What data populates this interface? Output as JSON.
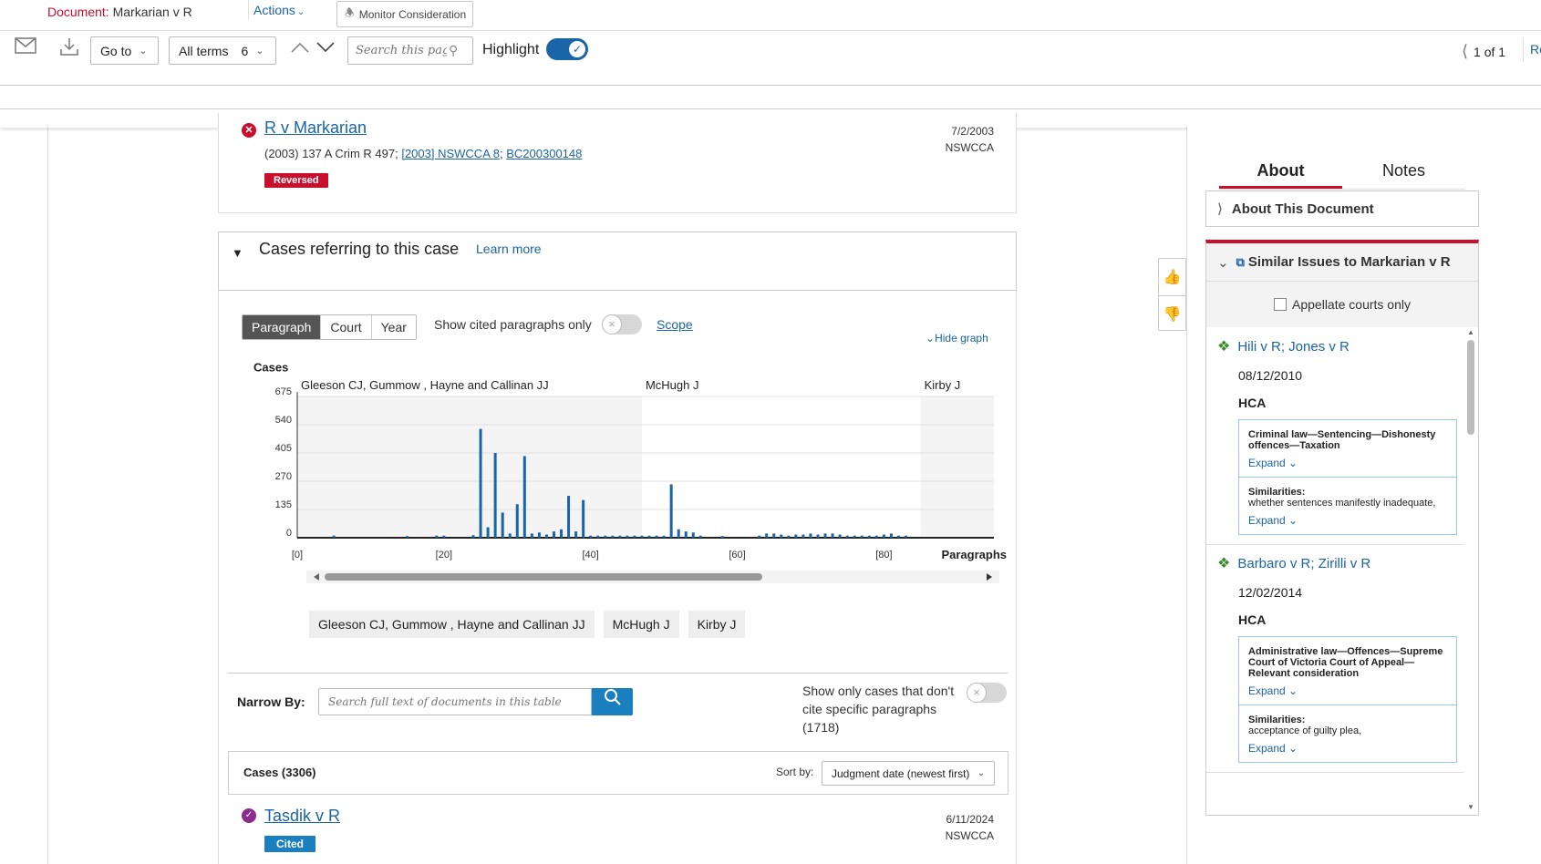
{
  "doc_bar": {
    "document_label": "Document:",
    "document_name": "Markarian v R",
    "actions": "Actions",
    "monitor": "Monitor Consideration"
  },
  "toolbar": {
    "goto": "Go to",
    "all_terms": "All terms",
    "term_count": "6",
    "search_placeholder": "Search this page",
    "highlight": "Highlight",
    "highlight_on": true,
    "pager": "1 of 1",
    "pager_next": "Re"
  },
  "top_case": {
    "title": "R v Markarian",
    "citation_prefix": "(2003) 137 A Crim R 497;",
    "citation_link1": "[2003] NSWCCA 8",
    "citation_sep": ";",
    "citation_link2": "BC200300148",
    "badge": "Reversed",
    "date": "7/2/2003",
    "court": "NSWCCA"
  },
  "cases_referring": {
    "title": "Cases referring to this case",
    "learn_more": "Learn more",
    "tabs": [
      "Paragraph",
      "Court",
      "Year"
    ],
    "active_tab": "Paragraph",
    "cited_only_label": "Show cited paragraphs only",
    "scope": "Scope",
    "hide_graph": "Hide graph",
    "judge_chips": [
      "Gleeson CJ, Gummow , Hayne and Callinan JJ",
      "McHugh J",
      "Kirby J"
    ],
    "narrow_by": "Narrow By:",
    "narrow_placeholder": "Search full text of documents in this table",
    "only_cases_label": "Show only cases that don't cite specific paragraphs",
    "only_cases_count": "(1718)",
    "cases_count_label": "Cases (3306)",
    "sort_by_label": "Sort by:",
    "sort_value": "Judgment date (newest first)"
  },
  "chart_data": {
    "type": "bar",
    "ylabel": "Cases",
    "xlabel": "Paragraphs",
    "ylim": [
      0,
      675
    ],
    "yticks": [
      0,
      135,
      270,
      405,
      540,
      675
    ],
    "xtick_labels": [
      "[0]",
      "[20]",
      "[40]",
      "[60]",
      "[80]"
    ],
    "xlim": [
      0,
      95
    ],
    "region_labels": [
      "Gleeson CJ, Gummow , Hayne and Callinan JJ",
      "McHugh J",
      "Kirby J"
    ],
    "regions": [
      {
        "label": "Gleeson CJ, Gummow , Hayne and Callinan JJ",
        "start": 0,
        "end": 47,
        "shaded": true
      },
      {
        "label": "McHugh J",
        "start": 47,
        "end": 85,
        "shaded": false
      },
      {
        "label": "Kirby J",
        "start": 85,
        "end": 95,
        "shaded": true
      }
    ],
    "color": "#1a64a8",
    "series": [
      {
        "x": [
          5,
          15,
          19,
          20,
          24,
          25,
          26,
          27,
          28,
          29,
          30,
          31,
          32,
          33,
          34,
          35,
          36,
          37,
          38,
          39,
          40,
          41,
          42,
          43,
          44,
          45,
          46,
          47,
          48,
          49,
          50,
          51,
          52,
          53,
          54,
          55,
          58,
          63,
          64,
          65,
          66,
          67,
          68,
          69,
          70,
          71,
          72,
          73,
          74,
          75,
          76,
          77,
          78,
          79,
          80,
          81,
          82,
          83
        ],
        "values": [
          10,
          8,
          10,
          10,
          12,
          520,
          50,
          405,
          120,
          20,
          160,
          390,
          20,
          25,
          15,
          30,
          40,
          200,
          30,
          180,
          10,
          10,
          10,
          10,
          10,
          10,
          10,
          10,
          10,
          10,
          10,
          255,
          40,
          30,
          25,
          10,
          8,
          10,
          20,
          20,
          15,
          10,
          15,
          15,
          20,
          15,
          20,
          20,
          15,
          10,
          10,
          10,
          10,
          10,
          15,
          20,
          10,
          10
        ]
      }
    ]
  },
  "bottom_case": {
    "title": "Tasdik v R",
    "badge": "Cited",
    "date": "6/11/2024",
    "court": "NSWCCA"
  },
  "right_panel": {
    "tabs": [
      "About",
      "Notes"
    ],
    "active_tab": "About",
    "about_doc": "About This Document",
    "similar_title": "Similar Issues to Markarian v R",
    "appellate_only": "Appellate courts only",
    "items": [
      {
        "title": "Hili v R; Jones v R",
        "date": "08/12/2010",
        "court": "HCA",
        "issue": "Criminal law—Sentencing—Dishonesty offences—Taxation",
        "similarities_label": "Similarities:",
        "similarities": "whether sentences manifestly inadequate,",
        "expand": "Expand"
      },
      {
        "title": "Barbaro v R; Zirilli v R",
        "date": "12/02/2014",
        "court": "HCA",
        "issue": "Administrative law—Offences—Supreme Court of Victoria Court of Appeal—Relevant consideration",
        "similarities_label": "Similarities:",
        "similarities": "acceptance of guilty plea,",
        "expand": "Expand"
      }
    ]
  },
  "colors": {
    "brand_red": "#c8102e",
    "link_blue": "#1a64a8",
    "cited_blue": "#1a7fbf",
    "judge_green": "#3c8a2e"
  },
  "icons": [
    "mail-icon",
    "download-icon",
    "search-icon",
    "bell-icon",
    "thumbs-up-icon",
    "thumbs-down-icon",
    "diamond-icon"
  ]
}
